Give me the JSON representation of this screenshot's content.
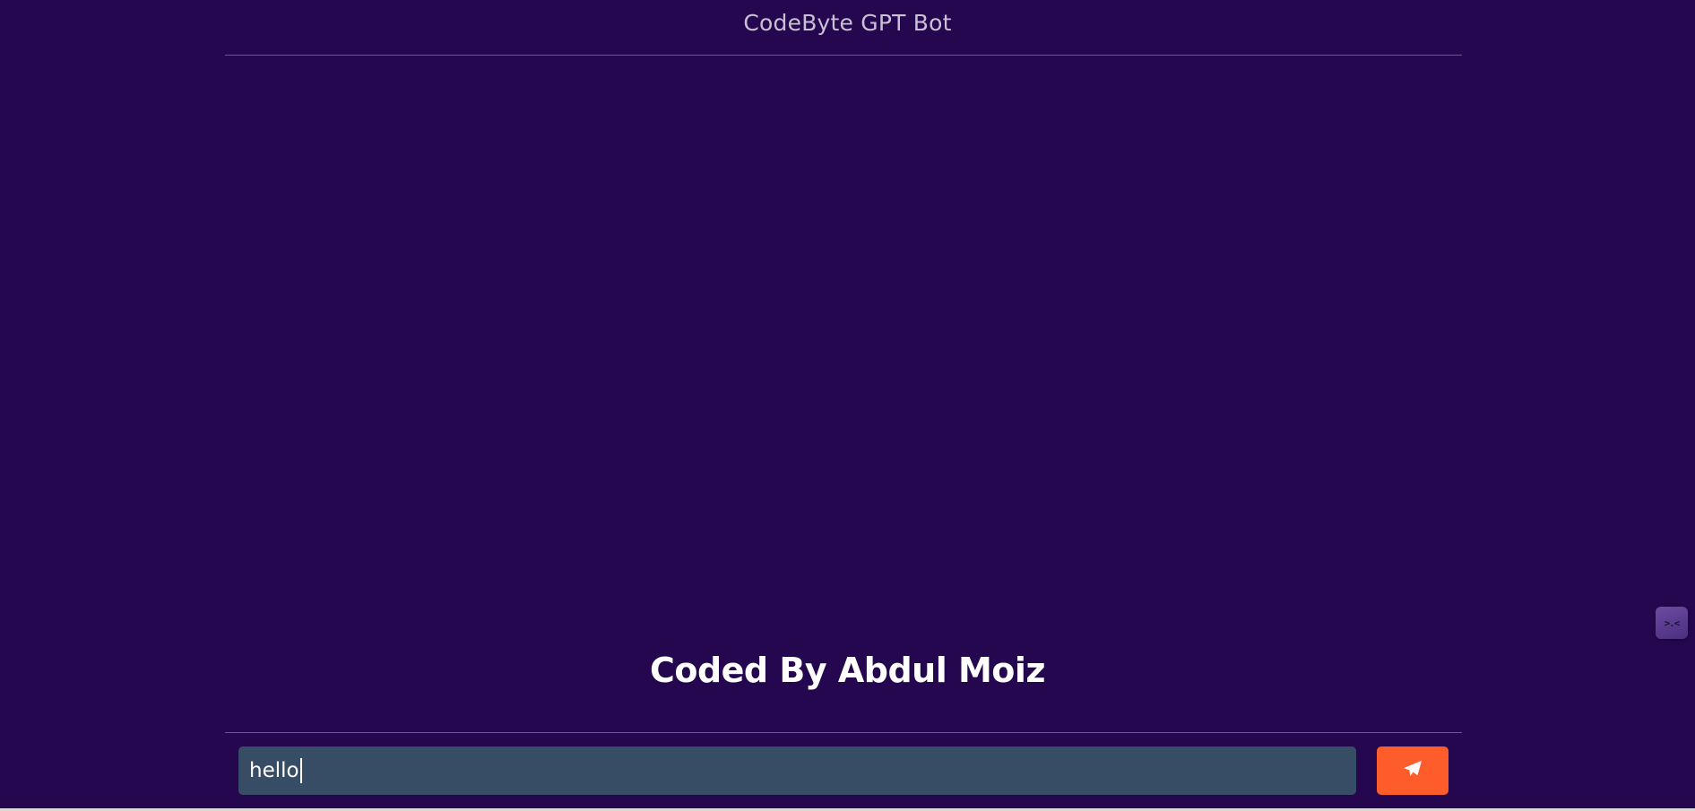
{
  "header": {
    "title": "CodeByte GPT Bot"
  },
  "footer": {
    "credit": "Coded By Abdul Moiz"
  },
  "composer": {
    "input_value": "hello",
    "send_icon": "paper-plane-icon"
  },
  "side_widget": {
    "face": ">.<",
    "icon": "assistant-face-icon"
  },
  "colors": {
    "background": "#25074f",
    "input_background": "#374d65",
    "send_button": "#ff5c2c",
    "title_text": "#c9c1d3",
    "credit_text": "#ffffff"
  }
}
